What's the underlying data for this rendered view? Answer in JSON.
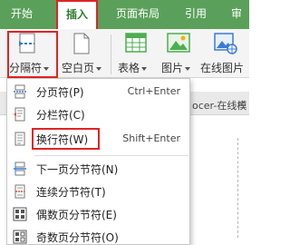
{
  "tabs": [
    {
      "label": "开始"
    },
    {
      "label": "插入"
    },
    {
      "label": "页面布局"
    },
    {
      "label": "引用"
    },
    {
      "label": "审"
    }
  ],
  "ribbon": {
    "section_break_label": "分隔符",
    "blank_page_label": "空白页",
    "table_label": "表格",
    "picture_label": "图片",
    "online_picture_label": "在线图片"
  },
  "document": {
    "tab_fragment": "ocer-在线模",
    "close_glyph": "×"
  },
  "menu": {
    "items": [
      {
        "label": "分页符(P)",
        "shortcut": "Ctrl+Enter",
        "icon": "page-break-icon"
      },
      {
        "label": "分栏符(C)",
        "shortcut": "",
        "icon": "column-break-icon"
      },
      {
        "label": "换行符(W)",
        "shortcut": "Shift+Enter",
        "icon": "line-break-icon"
      },
      {
        "label": "下一页分节符(N)",
        "shortcut": "",
        "icon": "next-page-section-icon"
      },
      {
        "label": "连续分节符(T)",
        "shortcut": "",
        "icon": "continuous-section-icon"
      },
      {
        "label": "偶数页分节符(E)",
        "shortcut": "",
        "icon": "even-page-section-icon"
      },
      {
        "label": "奇数页分节符(O)",
        "shortcut": "",
        "icon": "odd-page-section-icon"
      }
    ]
  },
  "colors": {
    "tab_bar": "#5aa05a",
    "highlight_box": "#e02424",
    "icon_blue": "#3a7bd5",
    "icon_green": "#4caf50"
  }
}
